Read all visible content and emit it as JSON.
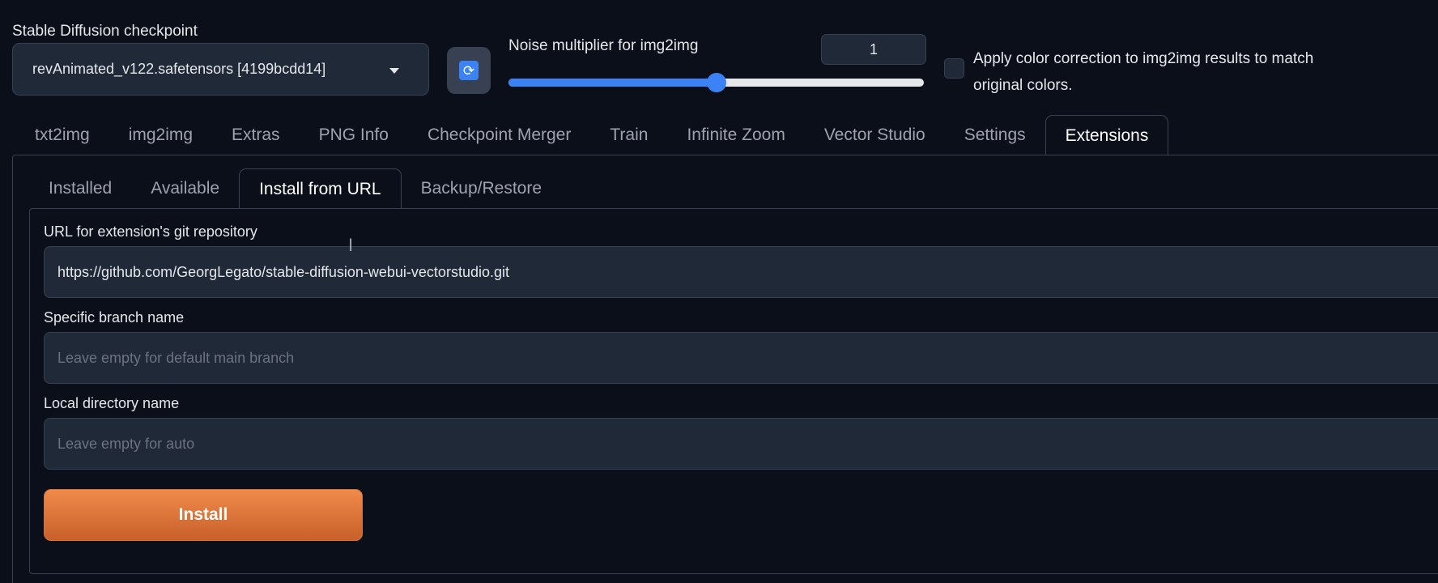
{
  "header": {
    "checkpoint_label": "Stable Diffusion checkpoint",
    "checkpoint_value": "revAnimated_v122.safetensors [4199bcdd14]",
    "refresh_icon": "refresh-icon",
    "noise_label": "Noise multiplier for img2img",
    "noise_value": "1",
    "noise_slider_fraction": 0.5,
    "color_correction_label": "Apply color correction to img2img results to match original colors.",
    "color_correction_checked": false
  },
  "main_tabs": [
    {
      "label": "txt2img"
    },
    {
      "label": "img2img"
    },
    {
      "label": "Extras"
    },
    {
      "label": "PNG Info"
    },
    {
      "label": "Checkpoint Merger"
    },
    {
      "label": "Train"
    },
    {
      "label": "Infinite Zoom"
    },
    {
      "label": "Vector Studio"
    },
    {
      "label": "Settings"
    },
    {
      "label": "Extensions",
      "active": true
    }
  ],
  "sub_tabs": [
    {
      "label": "Installed"
    },
    {
      "label": "Available"
    },
    {
      "label": "Install from URL",
      "active": true
    },
    {
      "label": "Backup/Restore"
    }
  ],
  "form": {
    "url_label": "URL for extension's git repository",
    "url_value": "https://github.com/GeorgLegato/stable-diffusion-webui-vectorstudio.git",
    "branch_label": "Specific branch name",
    "branch_placeholder": "Leave empty for default main branch",
    "dir_label": "Local directory name",
    "dir_placeholder": "Leave empty for auto",
    "install_label": "Install"
  },
  "colors": {
    "background": "#0b0f19",
    "accent_blue": "#3b82f6",
    "install_orange": "#e0763a"
  }
}
